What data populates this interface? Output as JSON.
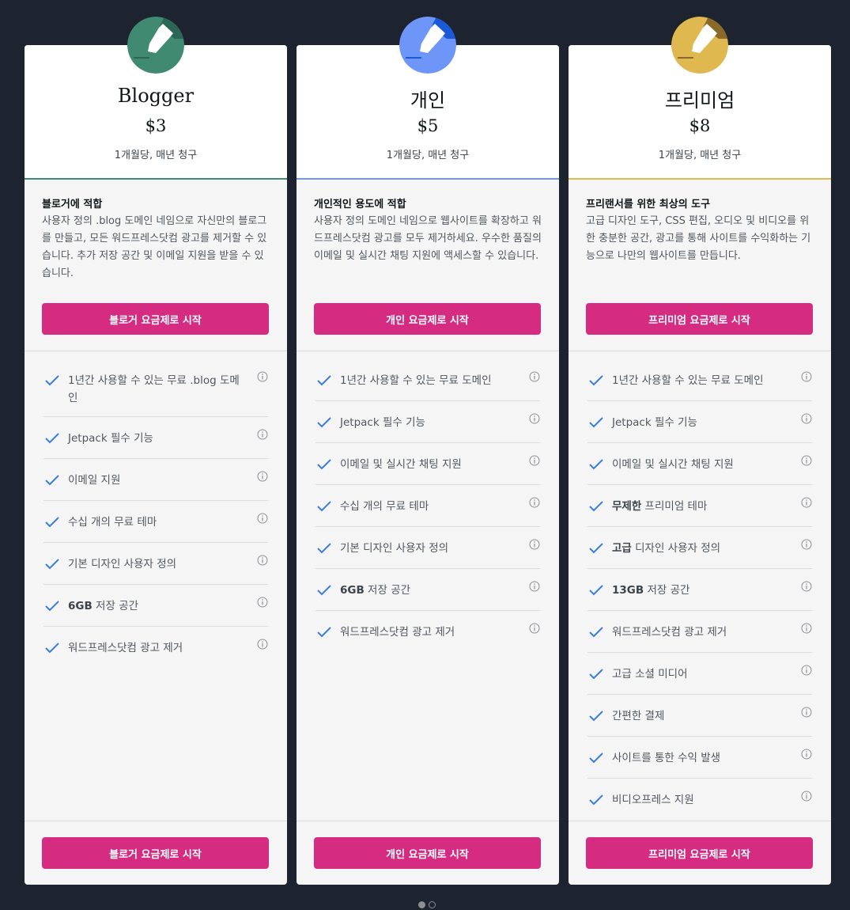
{
  "colors": {
    "cta_bg": "#d52c82",
    "blogger_accent": "#3f8a70",
    "personal_accent": "#6e96f9",
    "premium_accent": "#e4bb4f",
    "page_bg": "#1e2330"
  },
  "plans": [
    {
      "icon": "pen-icon-green",
      "name": "Blogger",
      "price": "$3",
      "billing": "1개월당, 매년 청구",
      "tagline": "블로거에 적합",
      "description": "사용자 정의 .blog 도메인 네임으로 자신만의 블로그를 만들고, 모든 워드프레스닷컴 광고를 제거할 수 있습니다. 추가 저장 공간 및 이메일 지원을 받을 수 있습니다.",
      "cta": "블로거 요금제로 시작",
      "features": [
        {
          "bold": "",
          "text": "1년간 사용할 수 있는 무료 .blog 도메인"
        },
        {
          "bold": "",
          "text": "Jetpack 필수 기능"
        },
        {
          "bold": "",
          "text": "이메일 지원"
        },
        {
          "bold": "",
          "text": "수십 개의 무료 테마"
        },
        {
          "bold": "",
          "text": "기본 디자인 사용자 정의"
        },
        {
          "bold": "6GB",
          "text": " 저장 공간"
        },
        {
          "bold": "",
          "text": "워드프레스닷컴 광고 제거"
        }
      ]
    },
    {
      "icon": "pen-icon-blue",
      "name": "개인",
      "price": "$5",
      "billing": "1개월당, 매년 청구",
      "tagline": "개인적인 용도에 적합",
      "description": "사용자 정의 도메인 네임으로 웹사이트를 확장하고 워드프레스닷컴 광고를 모두 제거하세요. 우수한 품질의 이메일 및 실시간 채팅 지원에 액세스할 수 있습니다.",
      "cta": "개인 요금제로 시작",
      "features": [
        {
          "bold": "",
          "text": "1년간 사용할 수 있는 무료 도메인"
        },
        {
          "bold": "",
          "text": "Jetpack 필수 기능"
        },
        {
          "bold": "",
          "text": "이메일 및 실시간 채팅 지원"
        },
        {
          "bold": "",
          "text": "수십 개의 무료 테마"
        },
        {
          "bold": "",
          "text": "기본 디자인 사용자 정의"
        },
        {
          "bold": "6GB",
          "text": " 저장 공간"
        },
        {
          "bold": "",
          "text": "워드프레스닷컴 광고 제거"
        }
      ]
    },
    {
      "icon": "pen-icon-gold",
      "name": "프리미엄",
      "price": "$8",
      "billing": "1개월당, 매년 청구",
      "tagline": "프리랜서를 위한 최상의 도구",
      "description": "고급 디자인 도구, CSS 편집, 오디오 및 비디오를 위한 충분한 공간, 광고를 통해 사이트를 수익화하는 기능으로 나만의 웹사이트를 만듭니다.",
      "cta": "프리미엄 요금제로 시작",
      "features": [
        {
          "bold": "",
          "text": "1년간 사용할 수 있는 무료 도메인"
        },
        {
          "bold": "",
          "text": "Jetpack 필수 기능"
        },
        {
          "bold": "",
          "text": "이메일 및 실시간 채팅 지원"
        },
        {
          "bold": "무제한",
          "text": " 프리미엄 테마"
        },
        {
          "bold": "고급",
          "text": " 디자인 사용자 정의"
        },
        {
          "bold": "13GB",
          "text": " 저장 공간"
        },
        {
          "bold": "",
          "text": "워드프레스닷컴 광고 제거"
        },
        {
          "bold": "",
          "text": "고급 소셜 미디어"
        },
        {
          "bold": "",
          "text": "간편한 결제"
        },
        {
          "bold": "",
          "text": "사이트를 통한 수익 발생"
        },
        {
          "bold": "",
          "text": "비디오프레스 지원"
        }
      ]
    }
  ],
  "pager": {
    "pages": 2,
    "current": 1
  }
}
